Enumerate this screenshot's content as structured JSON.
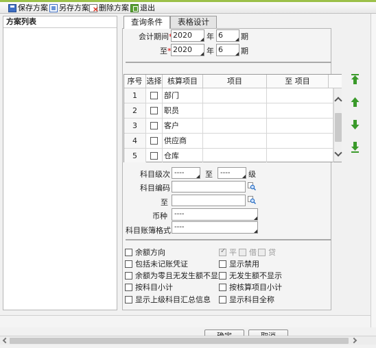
{
  "toolbar": {
    "save_label": "保存方案",
    "save_as_label": "另存方案",
    "delete_label": "删除方案",
    "exit_label": "退出"
  },
  "left_panel": {
    "title": "方案列表"
  },
  "tabs": [
    {
      "label": "查询条件",
      "active": true
    },
    {
      "label": "表格设计",
      "active": false
    }
  ],
  "period": {
    "label": "会计期间",
    "required_mark": "*",
    "from_year": "2020",
    "from_month": "6",
    "to_label": "至",
    "to_year": "2020",
    "to_month": "6",
    "year_unit": "年",
    "month_unit": "期"
  },
  "grid": {
    "headers": [
      "序号",
      "选择",
      "核算项目",
      "项目",
      "至 项目"
    ],
    "rows": [
      {
        "no": "1",
        "item": "部门"
      },
      {
        "no": "2",
        "item": "职员"
      },
      {
        "no": "3",
        "item": "客户"
      },
      {
        "no": "4",
        "item": "供应商"
      },
      {
        "no": "5",
        "item": "仓库"
      }
    ]
  },
  "filters": {
    "level_label": "科目级次",
    "level_from": "----",
    "level_to_label": "至",
    "level_to": "----",
    "level_unit": "级",
    "code_label": "科目编码",
    "code_value": "",
    "code_to_label": "至",
    "code_to_value": "",
    "currency_label": "币种",
    "currency_value": "----",
    "format_label": "科目账簿格式",
    "format_value": "----"
  },
  "options": {
    "balance_direction": "余额方向",
    "dir_flat": "平",
    "dir_debit": "借",
    "dir_credit": "贷",
    "include_unposted": "包括未记账凭证",
    "show_disabled": "显示禁用",
    "hide_zero_no_activity": "余额为零且无发生额不显示",
    "hide_no_activity": "无发生额不显示",
    "subtotal_by_account": "按科目小计",
    "subtotal_by_item": "按核算项目小计",
    "show_parent_summary": "显示上级科目汇总信息",
    "show_full_name": "显示科目全称"
  },
  "buttons": {
    "ok": "确定",
    "cancel": "取消"
  },
  "colors": {
    "top_band": "#9cc04a",
    "required": "#dd0000",
    "move_arrow": "#3a9a2a"
  }
}
